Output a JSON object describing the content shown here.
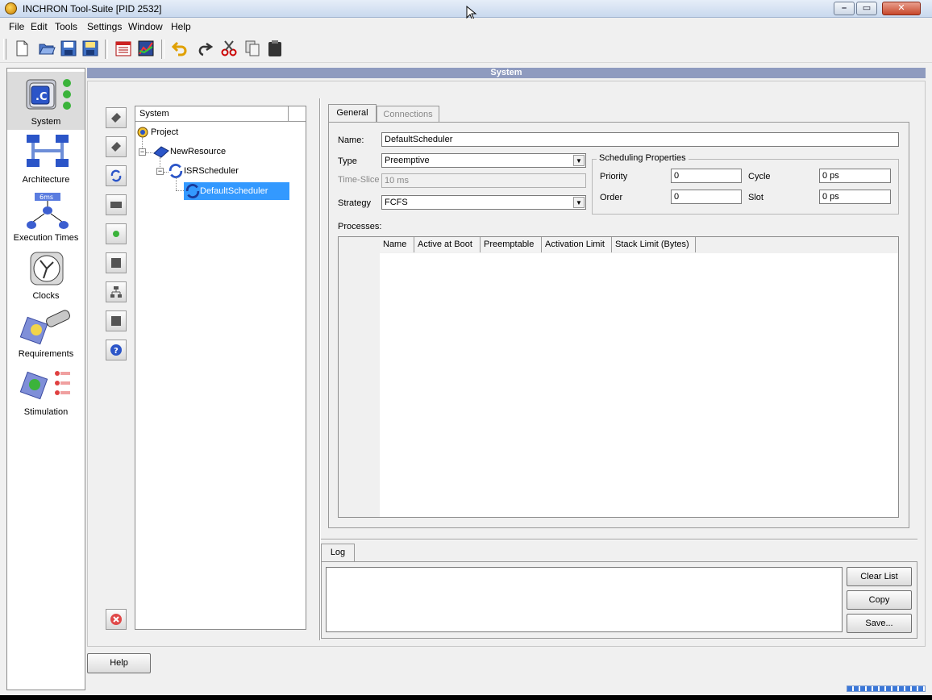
{
  "window": {
    "title": "INCHRON Tool-Suite [PID 2532]",
    "controls": [
      "minimize",
      "maximize",
      "close"
    ]
  },
  "menu": [
    {
      "label": "File",
      "accel": "F"
    },
    {
      "label": "Edit",
      "accel": "E"
    },
    {
      "label": "Tools",
      "accel": "T"
    },
    {
      "label": "Settings",
      "accel": "i"
    },
    {
      "label": "Window",
      "accel": "W"
    },
    {
      "label": "Help",
      "accel": "H"
    }
  ],
  "toolbar": [
    "new-icon",
    "open-icon",
    "save-icon",
    "save-all-icon",
    "calendar-icon",
    "chart-icon",
    "undo-icon",
    "redo-icon",
    "cut-icon",
    "copy-icon",
    "paste-icon"
  ],
  "nav": [
    {
      "label": "System",
      "icon": "system-icon",
      "active": true
    },
    {
      "label": "Architecture",
      "icon": "architecture-icon",
      "active": false
    },
    {
      "label": "Execution Times",
      "icon": "execution-times-icon",
      "active": false,
      "badge": "6ms"
    },
    {
      "label": "Clocks",
      "icon": "clock-icon",
      "active": false
    },
    {
      "label": "Requirements",
      "icon": "requirements-icon",
      "active": false
    },
    {
      "label": "Stimulation",
      "icon": "stimulation-icon",
      "active": false
    }
  ],
  "section_title": "System",
  "tree": {
    "header": "System",
    "items": [
      {
        "label": "Project",
        "level": 0,
        "icon": "project-icon"
      },
      {
        "label": "NewResource",
        "level": 1,
        "icon": "resource-icon"
      },
      {
        "label": "ISRScheduler",
        "level": 2,
        "icon": "scheduler-icon"
      },
      {
        "label": "DefaultScheduler",
        "level": 3,
        "icon": "scheduler-icon",
        "selected": true
      }
    ]
  },
  "tabs": {
    "general": "General",
    "connections": "Connections"
  },
  "form": {
    "name_label": "Name:",
    "name_value": "DefaultScheduler",
    "type_label": "Type",
    "type_value": "Preemptive",
    "timeslice_label": "Time-Slice",
    "timeslice_value": "10 ms",
    "strategy_label": "Strategy",
    "strategy_value": "FCFS",
    "sched_props_title": "Scheduling Properties",
    "priority_label": "Priority",
    "priority_value": "0",
    "cycle_label": "Cycle",
    "cycle_value": "0 ps",
    "order_label": "Order",
    "order_value": "0",
    "slot_label": "Slot",
    "slot_value": "0 ps",
    "processes_label": "Processes:"
  },
  "processes_table": {
    "columns": [
      "Name",
      "Active at Boot",
      "Preemptable",
      "Activation Limit",
      "Stack Limit (Bytes)"
    ],
    "rows": []
  },
  "log": {
    "tab": "Log",
    "clear": "Clear List",
    "copy": "Copy",
    "save": "Save..."
  },
  "help_button": "Help"
}
